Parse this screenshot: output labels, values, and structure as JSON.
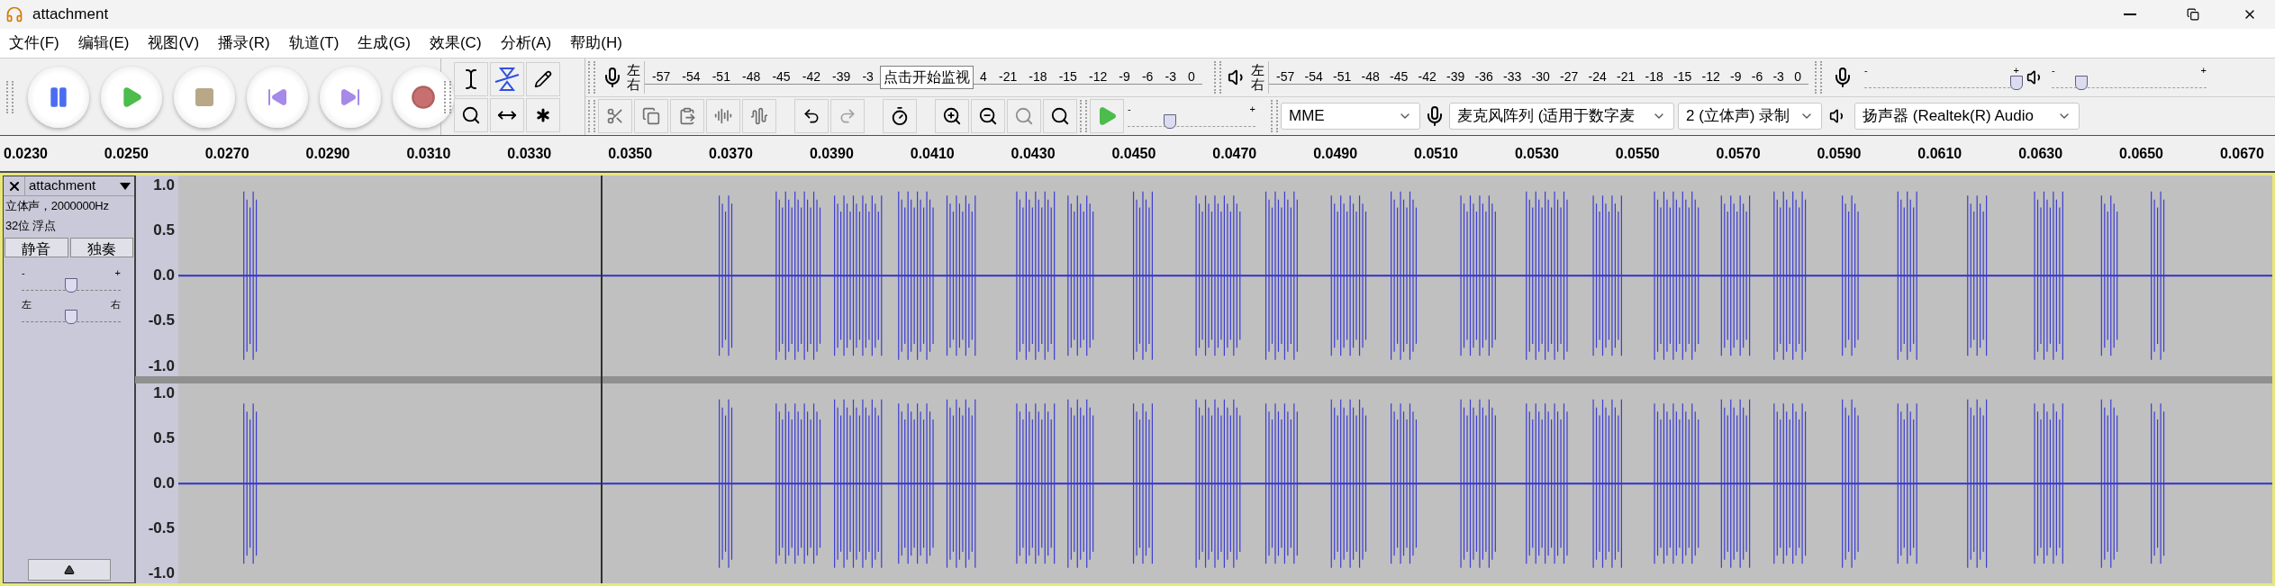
{
  "window": {
    "title": "attachment"
  },
  "menu": [
    {
      "label": "文件(F)"
    },
    {
      "label": "编辑(E)"
    },
    {
      "label": "视图(V)"
    },
    {
      "label": "播录(R)"
    },
    {
      "label": "轨道(T)"
    },
    {
      "label": "生成(G)"
    },
    {
      "label": "效果(C)"
    },
    {
      "label": "分析(A)"
    },
    {
      "label": "帮助(H)"
    }
  ],
  "record_meter": {
    "left": "左",
    "right": "右",
    "ticks_before": [
      "-57",
      "-54",
      "-51",
      "-48",
      "-45",
      "-42",
      "-39",
      "-3"
    ],
    "tooltip": "点击开始监视",
    "ticks_after": [
      "4",
      "-21",
      "-18",
      "-15",
      "-12",
      "-9",
      "-6",
      "-3",
      "0"
    ]
  },
  "playback_meter": {
    "left": "左",
    "right": "右",
    "ticks": [
      "-57",
      "-54",
      "-51",
      "-48",
      "-45",
      "-42",
      "-39",
      "-36",
      "-33",
      "-30",
      "-27",
      "-24",
      "-21",
      "-18",
      "-15",
      "-12",
      "-9",
      "-6",
      "-3",
      "0"
    ]
  },
  "mixer": {
    "record": {
      "minus": "-",
      "plus": "+",
      "level": 0.98
    },
    "playback": {
      "minus": "-",
      "plus": "+",
      "level": 0.19
    }
  },
  "play_at_speed": {
    "minus": "-",
    "plus": "+",
    "level": 0.33
  },
  "devices": {
    "host": "MME",
    "input": "麦克风阵列 (适用于数字麦",
    "channels": "2 (立体声) 录制",
    "output": "扬声器 (Realtek(R) Audio"
  },
  "ruler": [
    "0.0230",
    "0.0250",
    "0.0270",
    "0.0290",
    "0.0310",
    "0.0330",
    "0.0350",
    "0.0370",
    "0.0390",
    "0.0410",
    "0.0430",
    "0.0450",
    "0.0470",
    "0.0490",
    "0.0510",
    "0.0530",
    "0.0550",
    "0.0570",
    "0.0590",
    "0.0610",
    "0.0630",
    "0.0650",
    "0.0670"
  ],
  "track": {
    "name": "attachment",
    "info": [
      "立体声，2000000Hz",
      "32位 浮点"
    ],
    "mute": "静音",
    "solo": "独奏",
    "gain": {
      "minus": "-",
      "plus": "+",
      "level": 0.5
    },
    "pan": {
      "left": "左",
      "right": "右",
      "level": 0.5
    },
    "channels": [
      {
        "axis": [
          "1.0",
          "0.5",
          "0.0",
          "-0.5",
          "-1.0"
        ]
      },
      {
        "axis": [
          "1.0",
          "0.5",
          "0.0",
          "-0.5",
          "-1.0"
        ]
      }
    ]
  }
}
